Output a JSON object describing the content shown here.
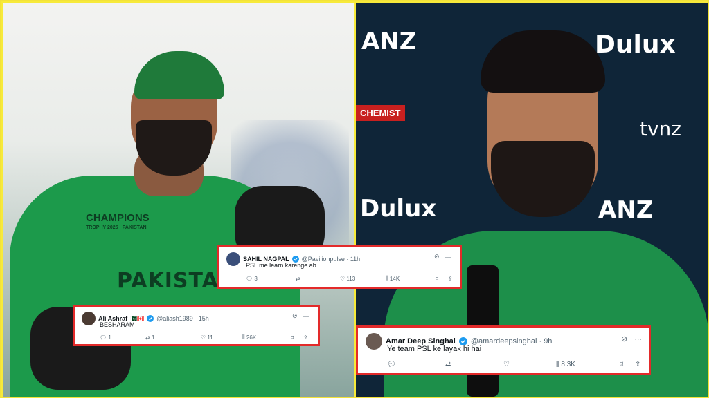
{
  "left_photo": {
    "champions_text": "CHAMPIONS",
    "trophy_text": "TROPHY 2025 · PAKISTAN",
    "jersey_text": "PAKISTAN"
  },
  "right_photo": {
    "sponsors": [
      "ANZ",
      "Dulux",
      "tvnz",
      "CHEMIST",
      "Dulux",
      "ANZ"
    ]
  },
  "tweets": [
    {
      "name": "SAHIL NAGPAL",
      "handle": "@Pavilionpulse · 11h",
      "text": "PSL me learn karenge ab",
      "replies": "3",
      "reposts": "",
      "likes": "113",
      "views": "14K"
    },
    {
      "name": "Ali Ashraf",
      "flags": "🇵🇰🇨🇦",
      "handle": "@aliash1989 · 15h",
      "text": "BESHARAM",
      "replies": "1",
      "reposts": "1",
      "likes": "11",
      "views": "26K"
    },
    {
      "name": "Amar Deep Singhal",
      "handle": "@amardeepsinghal · 9h",
      "text": "Ye team PSL ke layak hi hai",
      "replies": "",
      "reposts": "",
      "likes": "",
      "views": "8.3K"
    }
  ],
  "colors": {
    "border": "#f3e23a",
    "card_border": "#e32a2a",
    "verified": "#1d9bf0",
    "jersey_green": "#1c9a4b"
  }
}
